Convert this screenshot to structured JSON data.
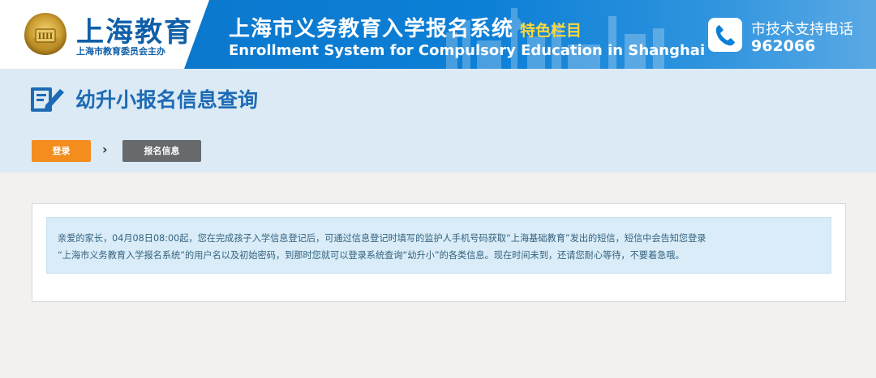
{
  "header": {
    "logo_title": "上海教育",
    "logo_subtitle": "上海市教育委员会主办",
    "system_title": "上海市义务教育入学报名系统",
    "system_tag": "特色栏目",
    "system_title_en": "Enrollment System for Compulsory Education in Shanghai",
    "support_label": "市技术支持电话",
    "support_number": "962066",
    "colors": {
      "brand_blue": "#0c7fd6",
      "tag_yellow": "#ffd93a"
    },
    "icons": [
      "education-badge-icon",
      "phone-icon"
    ]
  },
  "page": {
    "title": "幼升小报名信息查询",
    "title_icon": "edit-form-icon"
  },
  "steps": {
    "login_label": "登录",
    "arrow": "›",
    "info_label": "报名信息",
    "colors": {
      "active": "#f28d1e",
      "inactive": "#666a6d"
    }
  },
  "notice": {
    "line1": "亲爱的家长，04月08日08:00起，您在完成孩子入学信息登记后，可通过信息登记时填写的监护人手机号码获取“上海基础教育”发出的短信，短信中会告知您登录",
    "line2": "“上海市义务教育入学报名系统”的用户名以及初始密码，到那时您就可以登录系统查询“幼升小”的各类信息。现在时间未到，还请您耐心等待，不要着急哦。"
  }
}
